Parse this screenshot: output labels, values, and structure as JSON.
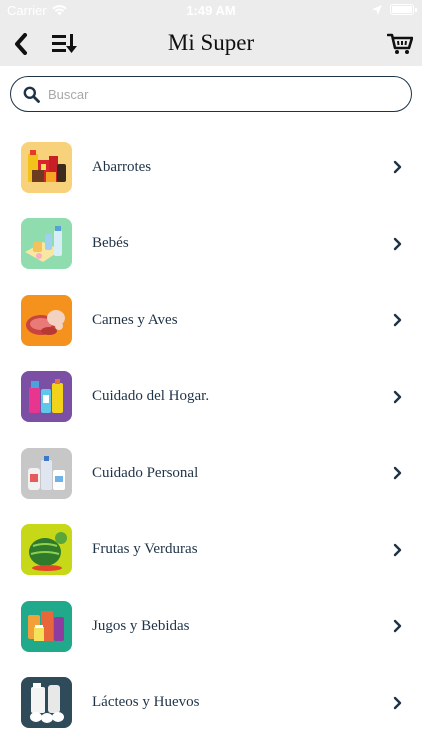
{
  "status_bar": {
    "carrier": "Carrier",
    "time": "1:49 AM"
  },
  "nav": {
    "title": "Mi Super",
    "back_icon": "chevron-left-icon",
    "sort_icon": "sort-list-icon",
    "cart_icon": "cart-icon"
  },
  "search": {
    "placeholder": "Buscar",
    "value": ""
  },
  "categories": [
    {
      "label": "Abarrotes",
      "icon": "groceries-icon",
      "color": "#f7d27a"
    },
    {
      "label": "Bebés",
      "icon": "baby-bottle-icon",
      "color": "#8fdcae"
    },
    {
      "label": "Carnes y Aves",
      "icon": "meat-icon",
      "color": "#f5921e"
    },
    {
      "label": "Cuidado del Hogar.",
      "icon": "cleaning-products-icon",
      "color": "#7b4fa3"
    },
    {
      "label": "Cuidado Personal",
      "icon": "personal-care-icon",
      "color": "#c7c7c7"
    },
    {
      "label": "Frutas y Verduras",
      "icon": "watermelon-icon",
      "color": "#c6d817"
    },
    {
      "label": "Jugos y Bebidas",
      "icon": "juice-icon",
      "color": "#21a98c"
    },
    {
      "label": "Lácteos y Huevos",
      "icon": "milk-eggs-icon",
      "color": "#2f4b59"
    }
  ]
}
